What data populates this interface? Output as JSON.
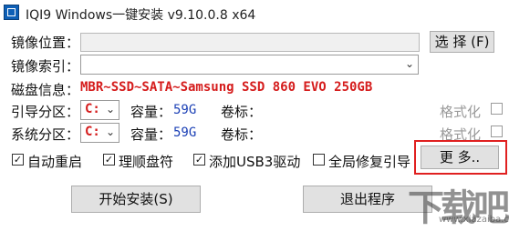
{
  "window": {
    "title": "IQI9 Windows一键安装 v9.10.0.8 x64"
  },
  "image_location": {
    "label": "镜像位置：",
    "value": ""
  },
  "browse_button": {
    "label": "选 择 (F)"
  },
  "image_index": {
    "label": "镜像索引：",
    "value": ""
  },
  "disk_info": {
    "label": "磁盘信息：",
    "value": "MBR~SSD~SATA~Samsung SSD 860 EVO 250GB"
  },
  "boot_partition": {
    "label": "引导分区：",
    "drive": "C:",
    "capacity_label": "容量：",
    "capacity": "59G",
    "volume_label": "卷标：",
    "format_label": "格式化"
  },
  "system_partition": {
    "label": "系统分区：",
    "drive": "C:",
    "capacity_label": "容量：",
    "capacity": "59G",
    "volume_label": "卷标：",
    "format_label": "格式化"
  },
  "options": {
    "auto_restart": {
      "label": "自动重启",
      "checked": true
    },
    "organize_disk": {
      "label": "理顺盘符",
      "checked": true
    },
    "add_usb3": {
      "label": "添加USB3驱动",
      "checked": true
    },
    "global_repair": {
      "label": "全局修复引导",
      "checked": false
    }
  },
  "more_button": {
    "label": "更 多.."
  },
  "start_button": {
    "label": "开始安装(S)"
  },
  "exit_button": {
    "label": "退出程序"
  },
  "watermark": {
    "text": "下载吧",
    "url": "www.xiazaiba.com"
  },
  "colors": {
    "disk_info": "#d51c1c",
    "capacity": "#1a3fb5",
    "highlight_box": "#e02020"
  }
}
